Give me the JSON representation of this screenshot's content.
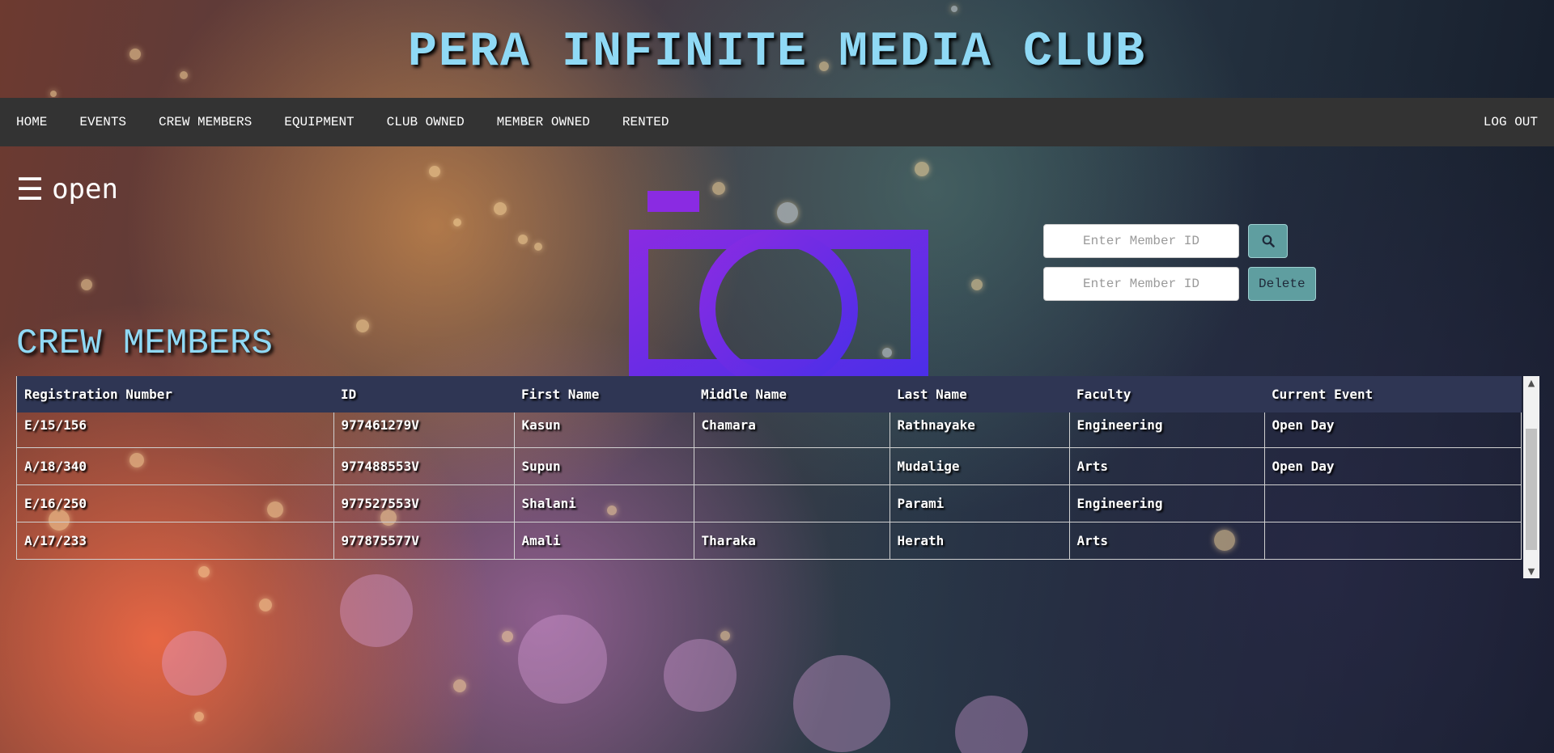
{
  "site": {
    "title": "PERA INFINITE MEDIA CLUB"
  },
  "nav": {
    "items": [
      {
        "label": "HOME"
      },
      {
        "label": "EVENTS"
      },
      {
        "label": "CREW MEMBERS"
      },
      {
        "label": "EQUIPMENT"
      },
      {
        "label": "CLUB OWNED"
      },
      {
        "label": "MEMBER OWNED"
      },
      {
        "label": "RENTED"
      }
    ],
    "logout_label": "LOG OUT"
  },
  "sidebar": {
    "toggle_glyph": "☰",
    "toggle_label": "open"
  },
  "logo": {
    "icon": "camera-icon",
    "color": "#6a2ee8"
  },
  "search": {
    "placeholder": "Enter Member ID",
    "search_icon": "magnifier-icon"
  },
  "remove": {
    "placeholder": "Enter Member ID",
    "delete_label": "Delete"
  },
  "crew": {
    "heading": "CREW MEMBERS",
    "columns": [
      "Registration Number",
      "ID",
      "First Name",
      "Middle Name",
      "Last Name",
      "Faculty",
      "Current Event"
    ],
    "rows": [
      [
        "E/15/156",
        "977461279V",
        "Kasun",
        "Chamara",
        "Rathnayake",
        "Engineering",
        "Open Day"
      ],
      [
        "A/18/340",
        "977488553V",
        "Supun",
        "",
        "Mudalige",
        "Arts",
        "Open Day"
      ],
      [
        "E/16/250",
        "977527553V",
        "Shalani",
        "",
        "Parami",
        "Engineering",
        ""
      ],
      [
        "A/17/233",
        "977875577V",
        "Amali",
        "Tharaka",
        "Herath",
        "Arts",
        ""
      ]
    ]
  },
  "colors": {
    "title": "#8fd9f5",
    "nav_bg": "#333333",
    "button": "#5f9ea0",
    "table_header": "#2f3654"
  }
}
